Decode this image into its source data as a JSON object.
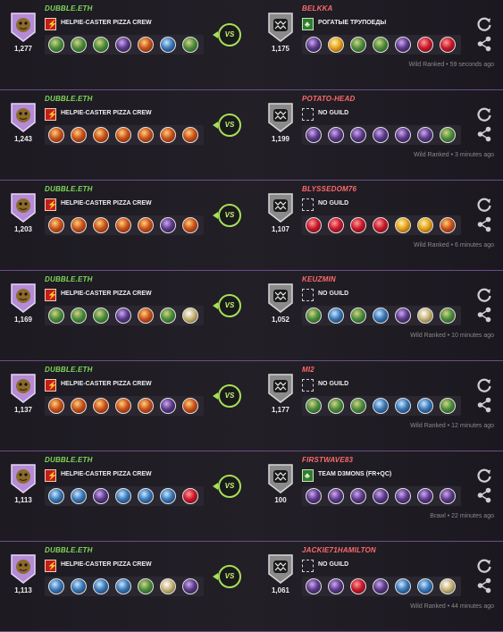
{
  "rows": [
    {
      "left": {
        "name": "DUBBLE.ETH",
        "rating": "1,277",
        "guild": "HELPIE-CASTER PIZZA CREW",
        "guild_icon": "red-banner",
        "team": [
          "earth",
          "earth",
          "earth",
          "death",
          "fire",
          "water",
          "earth"
        ]
      },
      "right": {
        "name": "BELKKA",
        "rating": "1,175",
        "guild": "РОГАТЫЕ ТРУПОЕДЫ",
        "guild_icon": "green-banner",
        "team": [
          "death",
          "gold",
          "earth",
          "earth",
          "death",
          "red",
          "red"
        ]
      },
      "meta": "Wild Ranked • 59 seconds ago"
    },
    {
      "left": {
        "name": "DUBBLE.ETH",
        "rating": "1,243",
        "guild": "HELPIE-CASTER PIZZA CREW",
        "guild_icon": "red-banner",
        "team": [
          "fire",
          "fire",
          "fire",
          "fire",
          "fire",
          "fire",
          "fire"
        ]
      },
      "right": {
        "name": "POTATO-HEAD",
        "rating": "1,199",
        "guild": "NO GUILD",
        "guild_icon": "empty",
        "team": [
          "death",
          "death",
          "death",
          "death",
          "death",
          "death",
          "earth"
        ]
      },
      "meta": "Wild Ranked • 3 minutes ago"
    },
    {
      "left": {
        "name": "DUBBLE.ETH",
        "rating": "1,203",
        "guild": "HELPIE-CASTER PIZZA CREW",
        "guild_icon": "red-banner",
        "team": [
          "fire",
          "fire",
          "fire",
          "fire",
          "fire",
          "death",
          "fire"
        ]
      },
      "right": {
        "name": "BLYSSEDOM76",
        "rating": "1,107",
        "guild": "NO GUILD",
        "guild_icon": "empty",
        "team": [
          "red",
          "red",
          "red",
          "red",
          "gold",
          "gold",
          "fire"
        ]
      },
      "meta": "Wild Ranked • 6 minutes ago"
    },
    {
      "left": {
        "name": "DUBBLE.ETH",
        "rating": "1,169",
        "guild": "HELPIE-CASTER PIZZA CREW",
        "guild_icon": "red-banner",
        "team": [
          "earth",
          "earth",
          "earth",
          "death",
          "fire",
          "earth",
          "life"
        ]
      },
      "right": {
        "name": "KEUZMIN",
        "rating": "1,052",
        "guild": "NO GUILD",
        "guild_icon": "empty",
        "team": [
          "earth",
          "water",
          "earth",
          "water",
          "death",
          "life",
          "earth"
        ]
      },
      "meta": "Wild Ranked • 10 minutes ago"
    },
    {
      "left": {
        "name": "DUBBLE.ETH",
        "rating": "1,137",
        "guild": "HELPIE-CASTER PIZZA CREW",
        "guild_icon": "red-banner",
        "team": [
          "fire",
          "fire",
          "fire",
          "fire",
          "fire",
          "death",
          "fire"
        ]
      },
      "right": {
        "name": "MI2",
        "rating": "1,177",
        "guild": "NO GUILD",
        "guild_icon": "empty",
        "team": [
          "earth",
          "earth",
          "earth",
          "water",
          "water",
          "water",
          "earth"
        ]
      },
      "meta": "Wild Ranked • 12 minutes ago"
    },
    {
      "left": {
        "name": "DUBBLE.ETH",
        "rating": "1,113",
        "guild": "HELPIE-CASTER PIZZA CREW",
        "guild_icon": "red-banner",
        "team": [
          "water",
          "water",
          "death",
          "water",
          "water",
          "water",
          "red"
        ]
      },
      "right": {
        "name": "FIRSTWAVE83",
        "rating": "100",
        "guild": "TEAM D3MONS (FR+QC)",
        "guild_icon": "green-banner",
        "team": [
          "death",
          "death",
          "death",
          "death",
          "death",
          "death",
          "death"
        ]
      },
      "meta": "Brawl • 22 minutes ago"
    },
    {
      "left": {
        "name": "DUBBLE.ETH",
        "rating": "1,113",
        "guild": "HELPIE-CASTER PIZZA CREW",
        "guild_icon": "red-banner",
        "team": [
          "water",
          "water",
          "water",
          "water",
          "earth",
          "life",
          "death"
        ]
      },
      "right": {
        "name": "JACKIE71HAMILTON",
        "rating": "1,061",
        "guild": "NO GUILD",
        "guild_icon": "empty",
        "team": [
          "death",
          "death",
          "red",
          "death",
          "water",
          "water",
          "life"
        ]
      },
      "meta": "Wild Ranked • 44 minutes ago"
    }
  ],
  "vs_label": "VS",
  "icons": {
    "replay": "replay-icon",
    "share": "share-icon",
    "left_badge": "potato-avatar-badge",
    "right_badge": "monster-mask-badge"
  },
  "colors": {
    "accent": "#a6e05a",
    "player_left": "#7ed957",
    "player_right": "#ff6a6a",
    "divider": "#6a4f86"
  }
}
